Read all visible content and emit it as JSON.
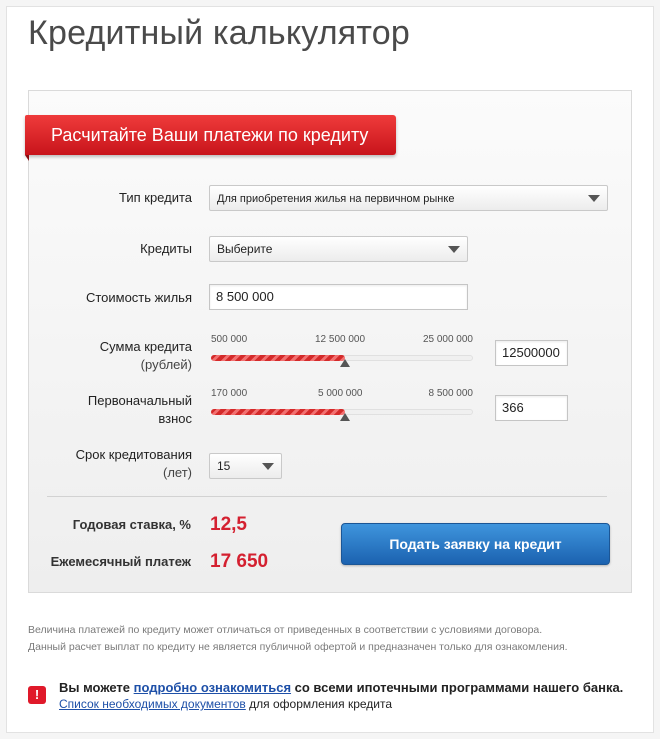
{
  "page": {
    "title": "Кредитный калькулятор"
  },
  "ribbon": {
    "label": "Расчитайте Ваши платежи по кредиту"
  },
  "form": {
    "loan_type": {
      "label": "Тип кредита",
      "value": "Для приобретения жилья на первичном рынке"
    },
    "credits": {
      "label": "Кредиты",
      "value": "Выберите"
    },
    "property_cost": {
      "label": "Стоимость жилья",
      "value": "8 500 000"
    },
    "loan_amount": {
      "label": "Сумма кредита",
      "sublabel": "(рублей)",
      "ticks": [
        "500 000",
        "12 500 000",
        "25 000 000"
      ],
      "min": 500000,
      "max": 25000000,
      "level": 0.51,
      "input_value": "12500000"
    },
    "down_payment": {
      "label": "Первоначальный",
      "label2": "взнос",
      "ticks": [
        "170 000",
        "5 000 000",
        "8 500 000"
      ],
      "min": 170000,
      "max": 8500000,
      "level": 0.51,
      "input_value": "366"
    },
    "term": {
      "label": "Срок кредитования",
      "sublabel": "(лет)",
      "value": "15"
    }
  },
  "results": {
    "rate_label": "Годовая ставка, %",
    "rate_value": "12,5",
    "payment_label": "Ежемесячный платеж",
    "payment_value": "17 650"
  },
  "apply_button": {
    "label": "Подать заявку на кредит"
  },
  "disclaimer": {
    "line1": "Величина платежей по кредиту может отличаться от приведенных в соответствии с условиями договора.",
    "line2": "Данный расчет выплат по кредиту не является публичной офертой и предназначен только для ознакомления."
  },
  "info": {
    "icon_glyph": "!",
    "text1_before": "Вы можете ",
    "text1_link": "подробно ознакомиться",
    "text1_after": " со всеми ипотечными программами нашего банка.",
    "text2_link": "Список необходимых документов",
    "text2_after": " для оформления кредита"
  }
}
